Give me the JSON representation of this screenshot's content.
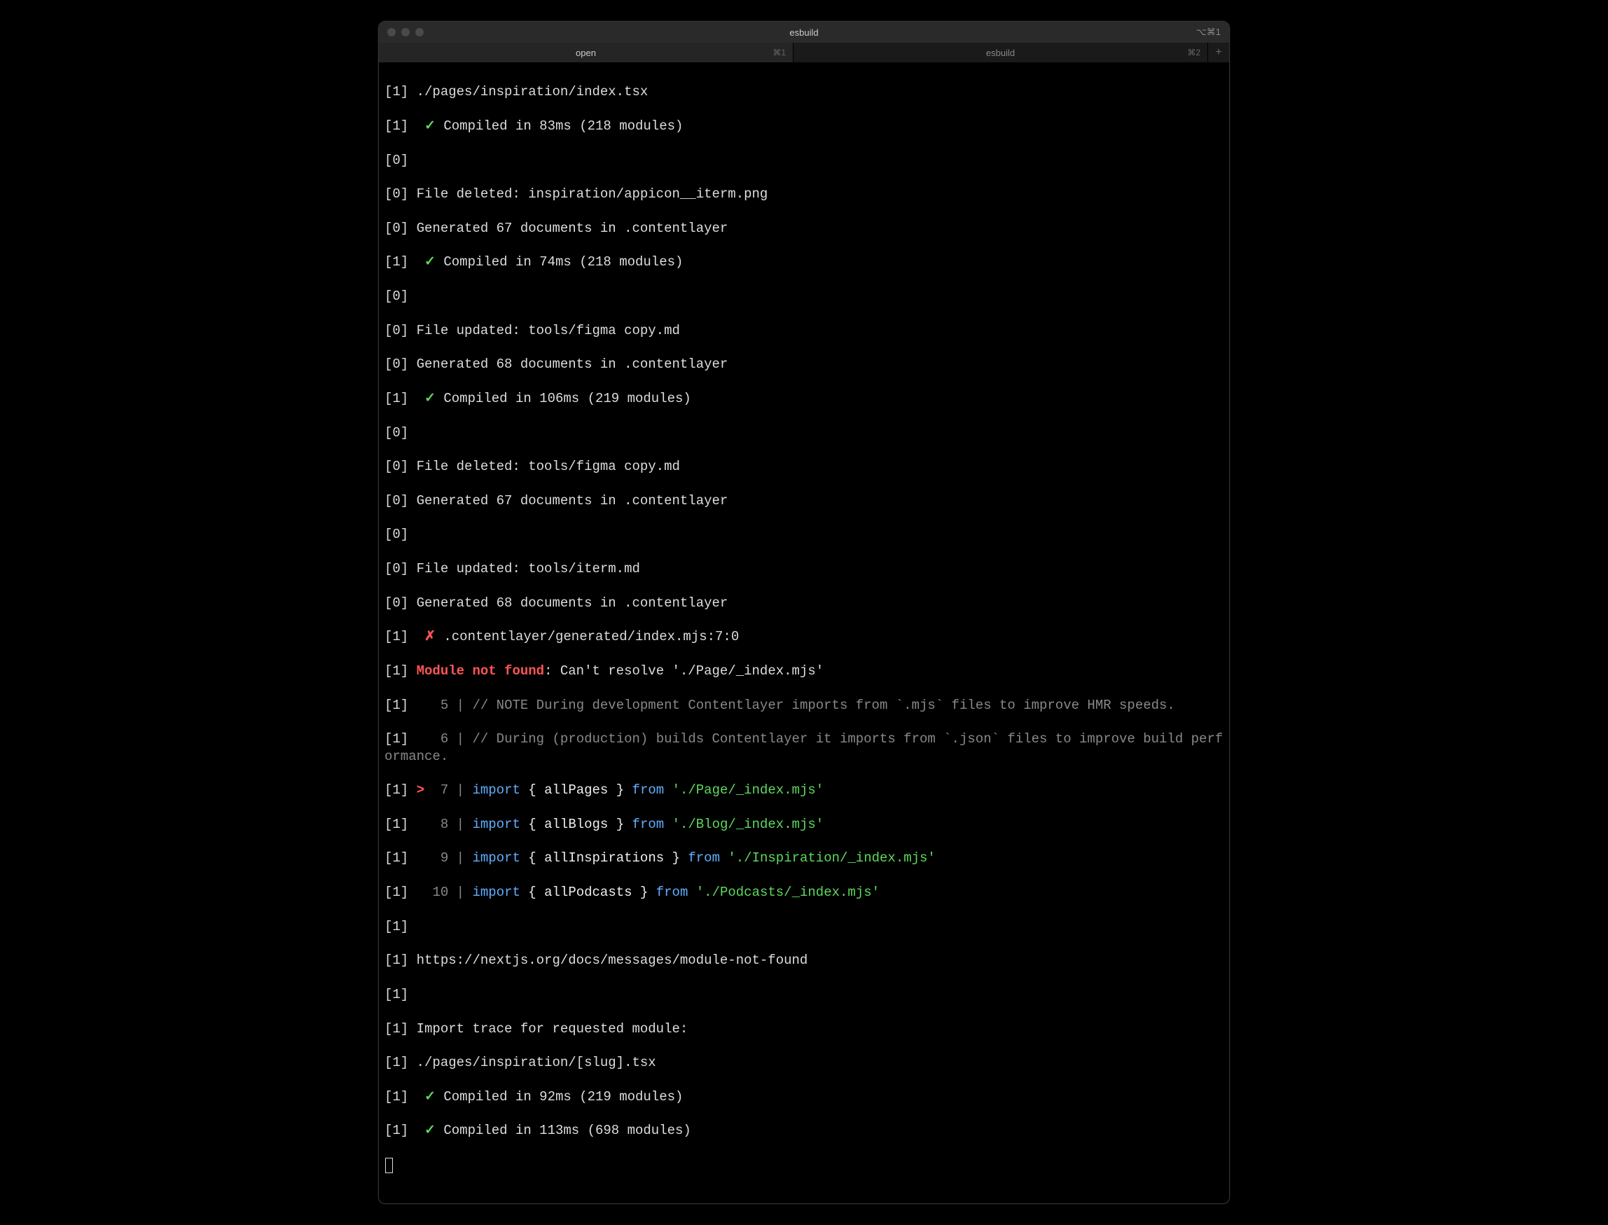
{
  "window": {
    "title": "esbuild",
    "title_right_shortcut": "⌥⌘1"
  },
  "tabs": [
    {
      "label": "open",
      "shortcut": "⌘1",
      "active": true
    },
    {
      "label": "esbuild",
      "shortcut": "⌘2",
      "active": false
    }
  ],
  "tag": {
    "0": "[0]",
    "1": "[1]"
  },
  "marks": {
    "check": "✓",
    "cross": "✗",
    "caret": ">"
  },
  "lines": {
    "l1": "./pages/inspiration/index.tsx",
    "l2a": "Compiled in 83ms (218 modules)",
    "l3": "",
    "l4": "File deleted: inspiration/appicon__iterm.png",
    "l5": "Generated 67 documents in .contentlayer",
    "l6a": "Compiled in 74ms (218 modules)",
    "l7": "",
    "l8": "File updated: tools/figma copy.md",
    "l9": "Generated 68 documents in .contentlayer",
    "l10a": "Compiled in 106ms (219 modules)",
    "l11": "",
    "l12": "File deleted: tools/figma copy.md",
    "l13": "Generated 67 documents in .contentlayer",
    "l14": "",
    "l15": "File updated: tools/iterm.md",
    "l16": "Generated 68 documents in .contentlayer",
    "l17": ".contentlayer/generated/index.mjs:7:0",
    "l18_err": "Module not found",
    "l18_rest": ": Can't resolve './Page/_index.mjs'",
    "l19_num": "5",
    "l19_txt": "// NOTE During development Contentlayer imports from `.mjs` files to improve HMR speeds.",
    "l20_num": "6",
    "l20_txt": "// During (production) builds Contentlayer it imports from `.json` files to improve build performance.",
    "l21_num": "7",
    "l21_kw1": "import",
    "l21_br1": "{ ",
    "l21_name": "allPages",
    "l21_br2": " } ",
    "l21_kw2": "from",
    "l21_str": "'./Page/_index.mjs'",
    "l22_num": "8",
    "l22_name": "allBlogs",
    "l22_str": "'./Blog/_index.mjs'",
    "l23_num": "9",
    "l23_name": "allInspirations",
    "l23_str": "'./Inspiration/_index.mjs'",
    "l24_num": "10",
    "l24_name": "allPodcasts",
    "l24_str": "'./Podcasts/_index.mjs'",
    "l25": "",
    "l26": "https://nextjs.org/docs/messages/module-not-found",
    "l27": "",
    "l28": "Import trace for requested module:",
    "l29": "./pages/inspiration/[slug].tsx",
    "l30a": "Compiled in 92ms (219 modules)",
    "l31a": "Compiled in 113ms (698 modules)"
  },
  "sep": " | "
}
